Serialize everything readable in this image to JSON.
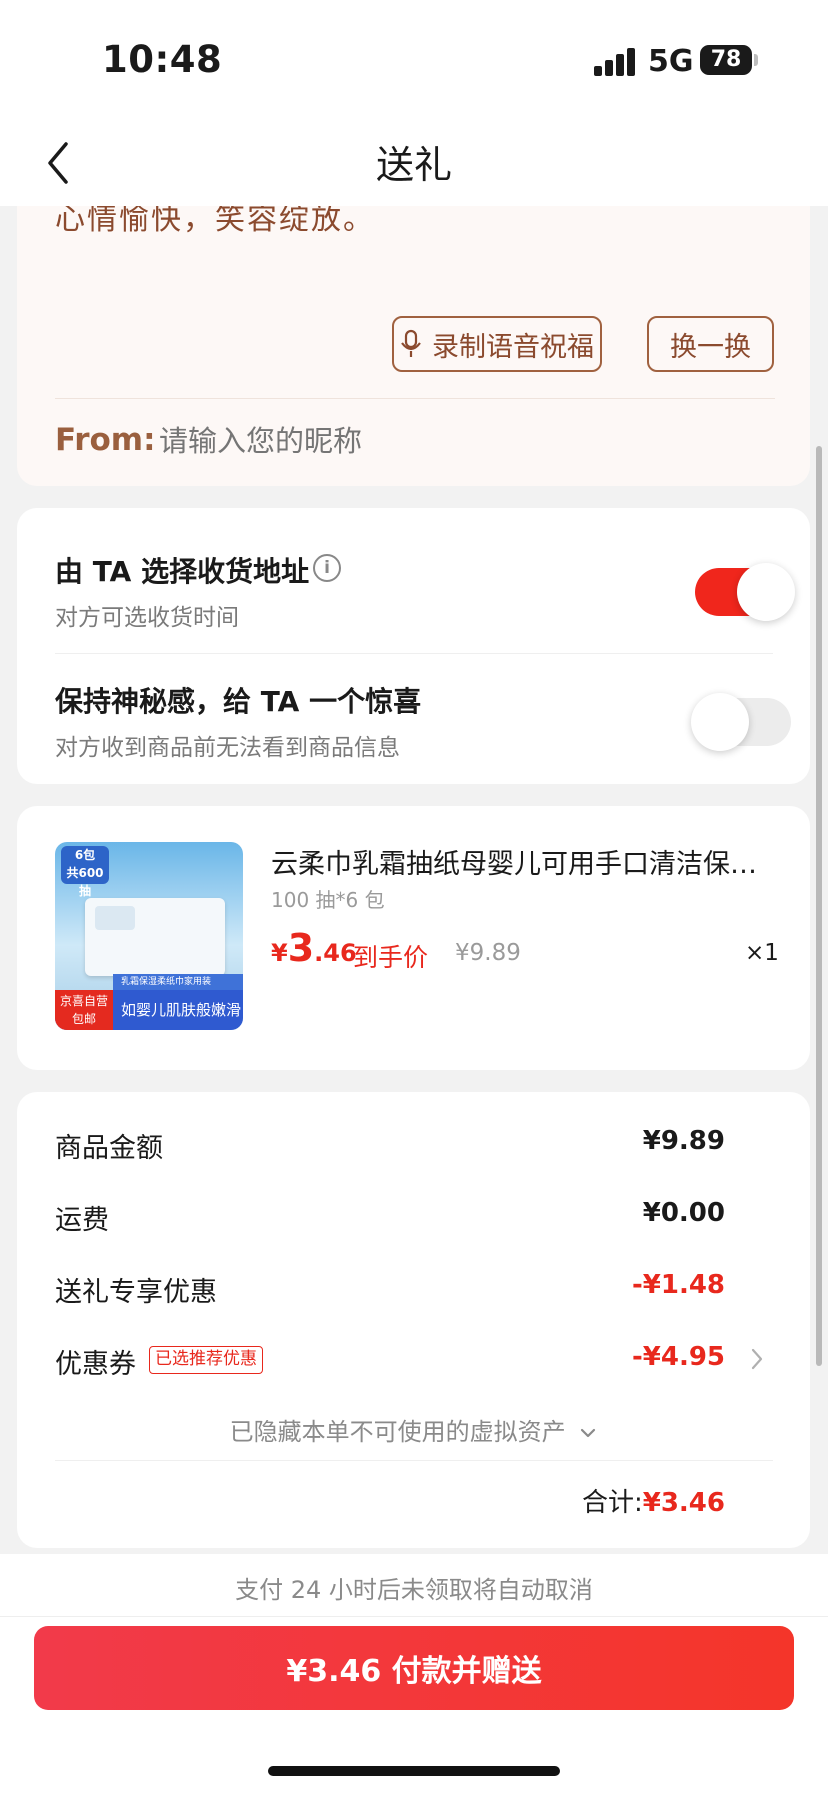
{
  "status_bar": {
    "time": "10:48",
    "network": "5G",
    "battery": "78"
  },
  "nav": {
    "title": "送礼"
  },
  "message_card": {
    "message_partial": "心情愉快，笑容绽放。",
    "voice_button": "录制语音祝福",
    "swap_button": "换一换",
    "from_label": "From:",
    "nickname_placeholder": "请输入您的昵称"
  },
  "options": {
    "address": {
      "title": "由 TA 选择收货地址",
      "subtitle": "对方可选收货时间",
      "enabled": true
    },
    "mystery": {
      "title": "保持神秘感，给 TA 一个惊喜",
      "subtitle": "对方收到商品前无法看到商品信息",
      "enabled": false
    }
  },
  "product": {
    "name": "云柔巾乳霜抽纸母婴儿可用手口清洁保…",
    "spec": "100 抽*6 包",
    "price_symbol": "¥",
    "price_int": "3",
    "price_dec": ".46",
    "price_tag": "到手价",
    "original_price": "¥9.89",
    "quantity": "×1",
    "thumb": {
      "badge_line1": "6包",
      "badge_line2": "共600抽",
      "strip": "乳霜保湿柔纸巾家用装",
      "red_line1": "京喜自营",
      "red_line2": "包邮",
      "foot": "如婴儿肌肤般嫩滑"
    }
  },
  "summary": {
    "rows": [
      {
        "label": "商品金额",
        "value": "¥9.89",
        "red": false
      },
      {
        "label": "运费",
        "value": "¥0.00",
        "red": false
      },
      {
        "label": "送礼专享优惠",
        "value": "-¥1.48",
        "red": true
      },
      {
        "label": "优惠券",
        "value": "-¥4.95",
        "red": true
      }
    ],
    "coupon_tag": "已选推荐优惠",
    "hidden_note": "已隐藏本单不可使用的虚拟资产",
    "total_label": "合计:",
    "total_value": "¥3.46"
  },
  "footer": {
    "auto_cancel_note": "支付 24 小时后未领取将自动取消",
    "pay_button": "¥3.46 付款并赠送"
  },
  "colors": {
    "accent_red": "#e8281d",
    "brown": "#8b4a2e"
  }
}
